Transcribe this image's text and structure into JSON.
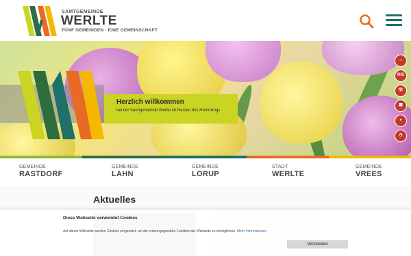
{
  "header": {
    "brand_small": "SAMTGEMEINDE",
    "brand_big": "WERLTE",
    "brand_tagline": "FÜNF GEMEINDEN - EINE GEMEINSCHAFT",
    "search_icon": "search-icon",
    "menu_icon": "hamburger-menu-icon"
  },
  "colors": {
    "green": "#8cb832",
    "dark_green": "#2e6d3e",
    "teal": "#1f6f6a",
    "red": "#c23a2a",
    "orange": "#e86a23",
    "yellow": "#f4b800",
    "lime": "#c9d423"
  },
  "hero": {
    "welcome_title": "Herzlich willkommen",
    "welcome_subtitle": "bei der Samtgemeinde Werlte im Herzen des Hümmlings",
    "quick_links": [
      {
        "icon": "home-icon",
        "label": ""
      },
      {
        "icon": "ris-icon",
        "label": "RIS"
      },
      {
        "icon": "phone-icon",
        "label": ""
      },
      {
        "icon": "calendar-icon",
        "label": ""
      },
      {
        "icon": "map-marker-icon",
        "label": ""
      },
      {
        "icon": "clock-icon",
        "label": ""
      }
    ]
  },
  "municipalities": [
    {
      "small": "GEMEINDE",
      "big": "RASTDORF"
    },
    {
      "small": "GEMEINDE",
      "big": "LAHN"
    },
    {
      "small": "GEMEINDE",
      "big": "LORUP"
    },
    {
      "small": "STADT",
      "big": "WERLTE"
    },
    {
      "small": "GEMEINDE",
      "big": "VREES"
    }
  ],
  "content": {
    "section_title": "Aktuelles"
  },
  "cookie": {
    "title": "Diese Webseite verwendet Cookies",
    "text": "Auf dieser Webseite werden Cookies eingesetzt, um die ordnungsgemäße Funktion der Webseite zu ermöglichen.",
    "link": "Mehr Informationen",
    "button": "Verstanden"
  }
}
